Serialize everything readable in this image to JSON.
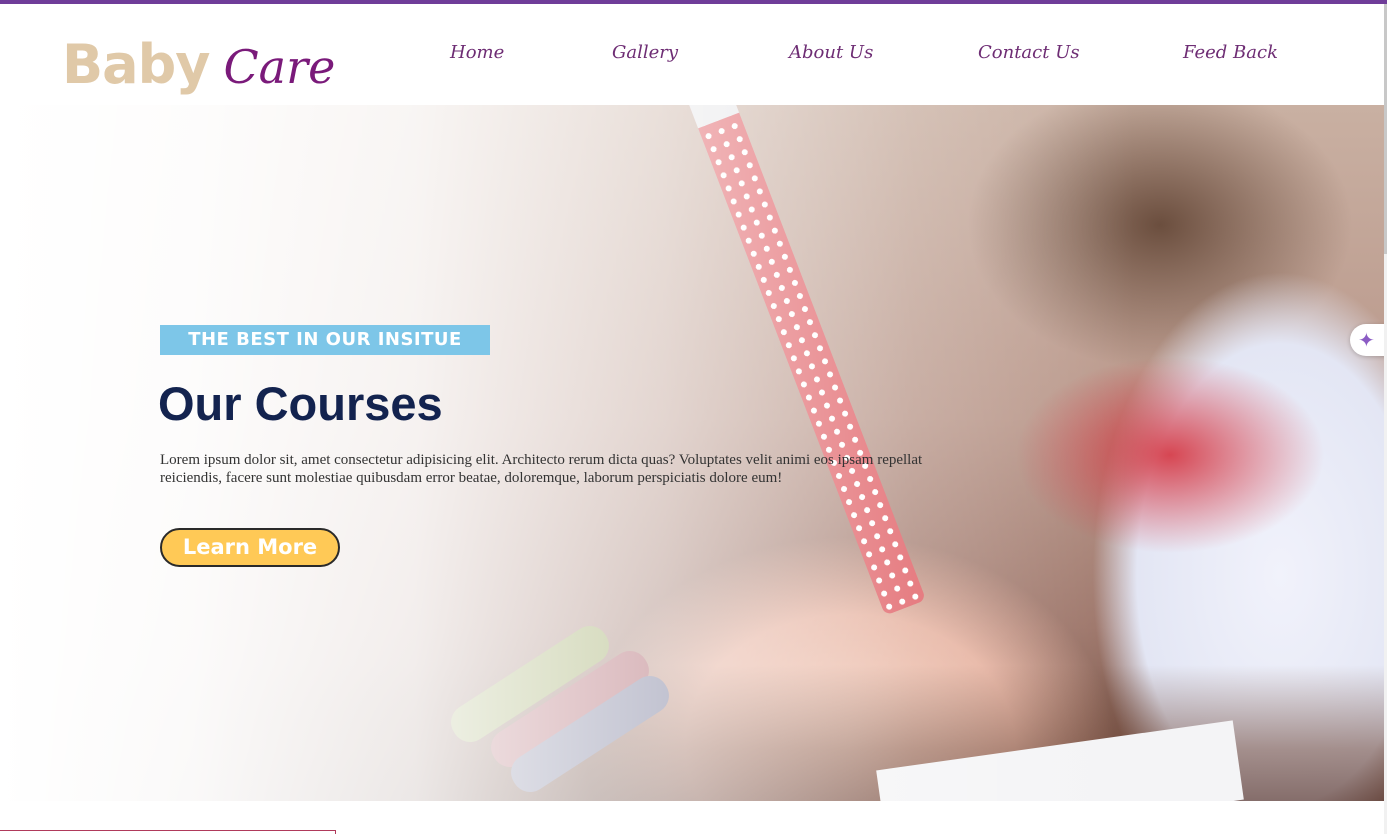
{
  "logo": {
    "part1": "Baby",
    "part2": "Care"
  },
  "nav": {
    "items": [
      {
        "label": "Home"
      },
      {
        "label": "Gallery"
      },
      {
        "label": "About Us"
      },
      {
        "label": "Contact Us"
      },
      {
        "label": "Feed Back"
      }
    ]
  },
  "hero": {
    "badge": "THE BEST IN OUR INSITUE",
    "title": "Our Courses",
    "description": "Lorem ipsum dolor sit, amet consectetur adipisicing elit. Architecto rerum dicta quas? Voluptates velit animi eos ipsam repellat reiciendis, facere sunt molestiae quibusdam error beatae, doloremque, laborum perspiciatis dolore eum!",
    "button_label": "Learn More"
  },
  "side_widget": {
    "icon": "sparkle-icon",
    "glyph": "✦"
  },
  "colors": {
    "accent_bar": "#6f3d99",
    "logo_part1": "#e0c9a8",
    "logo_part2": "#7a1a7a",
    "nav_text": "#6e2d74",
    "badge_bg": "#7dc6e8",
    "title": "#13234f",
    "button_bg": "#ffc956"
  }
}
